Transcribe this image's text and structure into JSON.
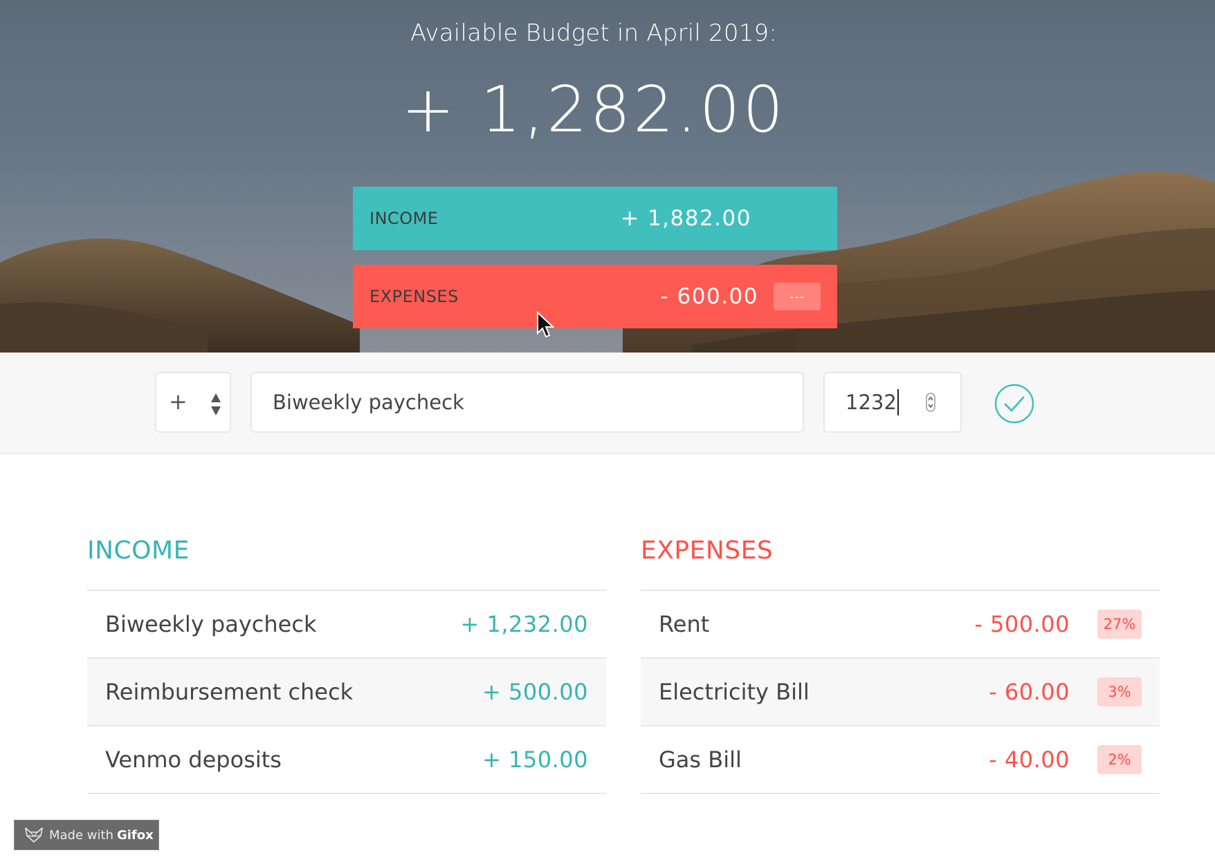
{
  "header": {
    "title": "Available Budget in April 2019:",
    "budget": "+ 1,282.00"
  },
  "summary": {
    "income": {
      "label": "INCOME",
      "value": "+ 1,882.00"
    },
    "expenses": {
      "label": "EXPENSES",
      "value": "- 600.00",
      "percentage": "---"
    }
  },
  "add_form": {
    "type_value": "+",
    "description_value": "Biweekly paycheck",
    "amount_value": "1232"
  },
  "income": {
    "heading": "INCOME",
    "items": [
      {
        "description": "Biweekly paycheck",
        "value": "+ 1,232.00"
      },
      {
        "description": "Reimbursement check",
        "value": "+ 500.00"
      },
      {
        "description": "Venmo deposits",
        "value": "+ 150.00"
      }
    ]
  },
  "expenses": {
    "heading": "EXPENSES",
    "items": [
      {
        "description": "Rent",
        "value": "- 500.00",
        "percentage": "27%"
      },
      {
        "description": "Electricity Bill",
        "value": "- 60.00",
        "percentage": "3%"
      },
      {
        "description": "Gas Bill",
        "value": "- 40.00",
        "percentage": "2%"
      }
    ]
  },
  "watermark": {
    "prefix": "Made with",
    "brand": "Gifox"
  },
  "colors": {
    "income": "#41bfbd",
    "expense": "#fe5a52",
    "income_text": "#33b5b3",
    "expense_text": "#ff5049"
  },
  "icons": {
    "type_select": "up-down-arrows-icon",
    "add": "check-circle-icon",
    "cursor": "mouse-pointer-icon",
    "watermark": "fox-icon"
  }
}
